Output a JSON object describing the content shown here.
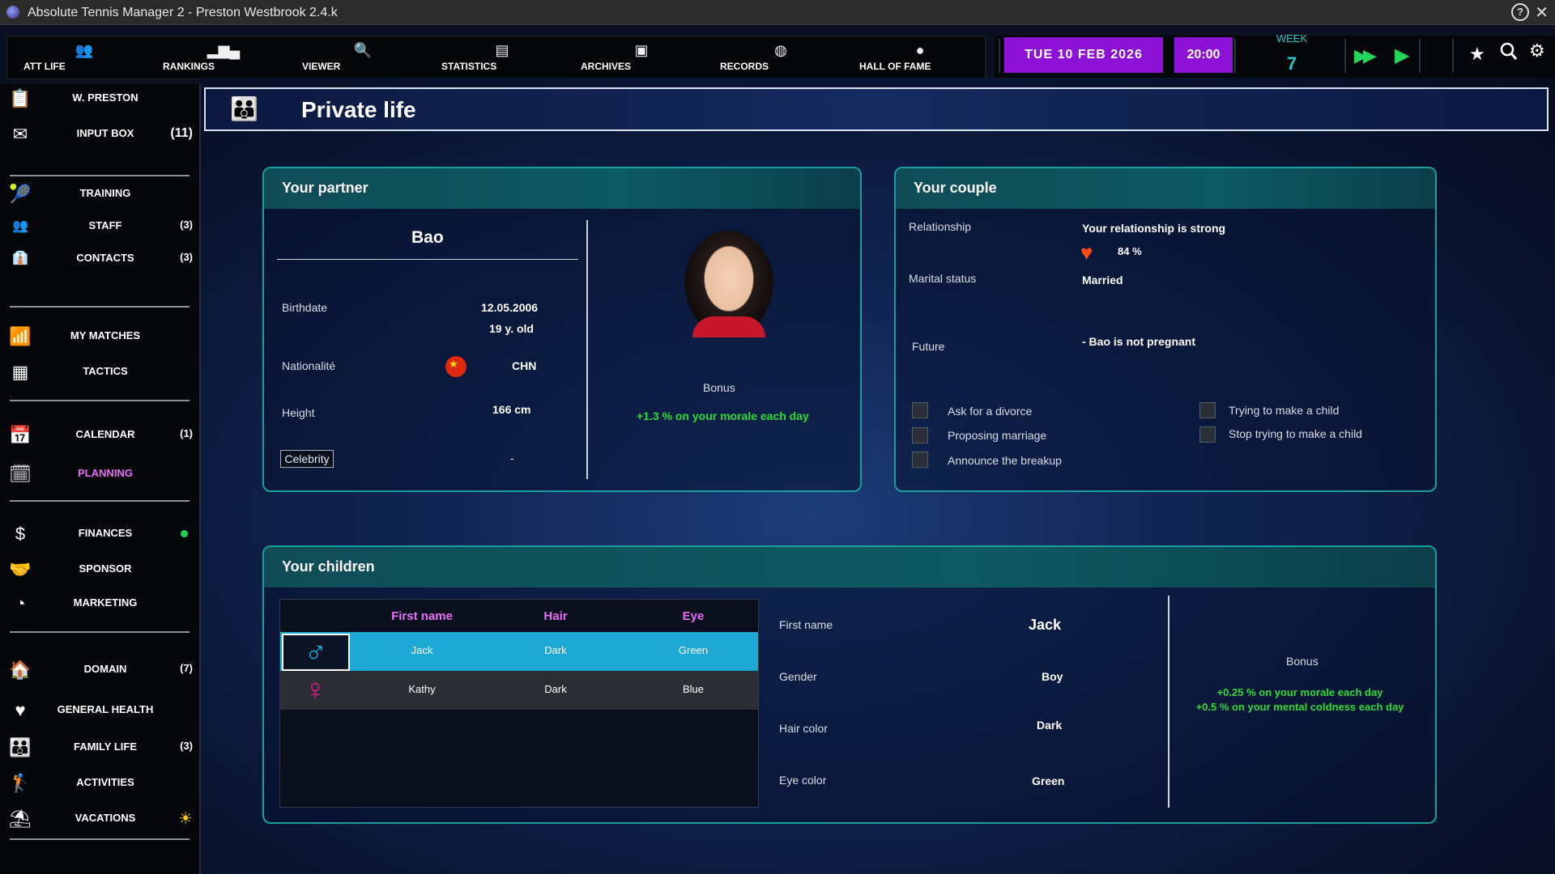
{
  "window": {
    "title": "Absolute Tennis Manager 2  -  Preston Westbrook  2.4.k",
    "help_label": "?",
    "close_label": "✕"
  },
  "topnav": {
    "items": [
      {
        "label": "ATT LIFE",
        "icon": "att-life-icon"
      },
      {
        "label": "RANKINGS",
        "icon": "podium-icon"
      },
      {
        "label": "VIEWER",
        "icon": "magnifier-icon"
      },
      {
        "label": "STATISTICS",
        "icon": "chart-icon"
      },
      {
        "label": "ARCHIVES",
        "icon": "archive-icon"
      },
      {
        "label": "RECORDS",
        "icon": "records-icon"
      },
      {
        "label": "HALL OF FAME",
        "icon": "trophy-icon"
      }
    ],
    "date": "TUE  10  FEB  2026",
    "time": "20:00",
    "week_label": "WEEK",
    "week_number": "7"
  },
  "sidebar": {
    "items": [
      {
        "label": "W. PRESTON",
        "icon": "clipboard-icon",
        "count": ""
      },
      {
        "label": "INPUT BOX",
        "icon": "envelope-icon",
        "count": "(11)"
      },
      {
        "label": "TRAINING",
        "icon": "racket-icon",
        "count": ""
      },
      {
        "label": "STAFF",
        "icon": "staff-icon",
        "count": "(3)"
      },
      {
        "label": "CONTACTS",
        "icon": "contacts-icon",
        "count": "(3)"
      },
      {
        "label": "MY MATCHES",
        "icon": "bar-chart-icon",
        "count": ""
      },
      {
        "label": "TACTICS",
        "icon": "tactics-board-icon",
        "count": ""
      },
      {
        "label": "CALENDAR",
        "icon": "calendar-icon",
        "count": "(1)"
      },
      {
        "label": "PLANNING",
        "icon": "planning-icon",
        "count": ""
      },
      {
        "label": "FINANCES",
        "icon": "dollar-icon",
        "count": ""
      },
      {
        "label": "SPONSOR",
        "icon": "handshake-icon",
        "count": ""
      },
      {
        "label": "MARKETING",
        "icon": "pie-chart-icon",
        "count": ""
      },
      {
        "label": "DOMAIN",
        "icon": "house-icon",
        "count": "(7)"
      },
      {
        "label": "GENERAL HEALTH",
        "icon": "heart-icon",
        "count": ""
      },
      {
        "label": "FAMILY LIFE",
        "icon": "family-icon",
        "count": "(3)"
      },
      {
        "label": "ACTIVITIES",
        "icon": "golfer-icon",
        "count": ""
      },
      {
        "label": "VACATIONS",
        "icon": "beach-icon",
        "count": ""
      }
    ],
    "active": "PLANNING",
    "finances_status_color": "#21d35a"
  },
  "page": {
    "title": "Private life",
    "icon": "family-icon"
  },
  "partner": {
    "header": "Your partner",
    "name": "Bao",
    "birthdate_label": "Birthdate",
    "birthdate": "12.05.2006",
    "age": "19 y. old",
    "nationality_label": "Nationalité",
    "nationality": "CHN",
    "height_label": "Height",
    "height": "166 cm",
    "celebrity_label": "Celebrity",
    "celebrity_value": "-",
    "bonus_label": "Bonus",
    "bonus_value": "+1.3 % on your morale each day"
  },
  "couple": {
    "header": "Your couple",
    "relationship_label": "Relationship",
    "relationship_text": "Your relationship is strong",
    "relationship_percent": "84 %",
    "marital_label": "Marital status",
    "marital_value": "Married",
    "future_label": "Future",
    "future_value": "- Bao is not pregnant",
    "options_left": [
      "Ask for a divorce",
      "Proposing marriage",
      "Announce the breakup"
    ],
    "options_right": [
      "Trying to make a child",
      "Stop trying to make a child"
    ]
  },
  "children": {
    "header": "Your children",
    "columns": [
      "First name",
      "Hair",
      "Eye"
    ],
    "rows": [
      {
        "gender_icon": "male-symbol-icon",
        "first_name": "Jack",
        "hair": "Dark",
        "eye": "Green"
      },
      {
        "gender_icon": "female-symbol-icon",
        "first_name": "Kathy",
        "hair": "Dark",
        "eye": "Blue"
      }
    ],
    "selected_row": 0,
    "detail": {
      "first_name_label": "First name",
      "first_name": "Jack",
      "gender_label": "Gender",
      "gender": "Boy",
      "hair_label": "Hair color",
      "hair": "Dark",
      "eye_label": "Eye color",
      "eye": "Green"
    },
    "bonus_label": "Bonus",
    "bonus_lines": [
      "+0.25 % on your morale each day",
      "+0.5 % on your mental coldness each day"
    ]
  },
  "colors": {
    "accent_purple": "#8c12d6",
    "teal": "#1a9f9f",
    "highlight_blue": "#1ea8d6",
    "bonus_green": "#2bdc37",
    "pink": "#e86ff5"
  }
}
